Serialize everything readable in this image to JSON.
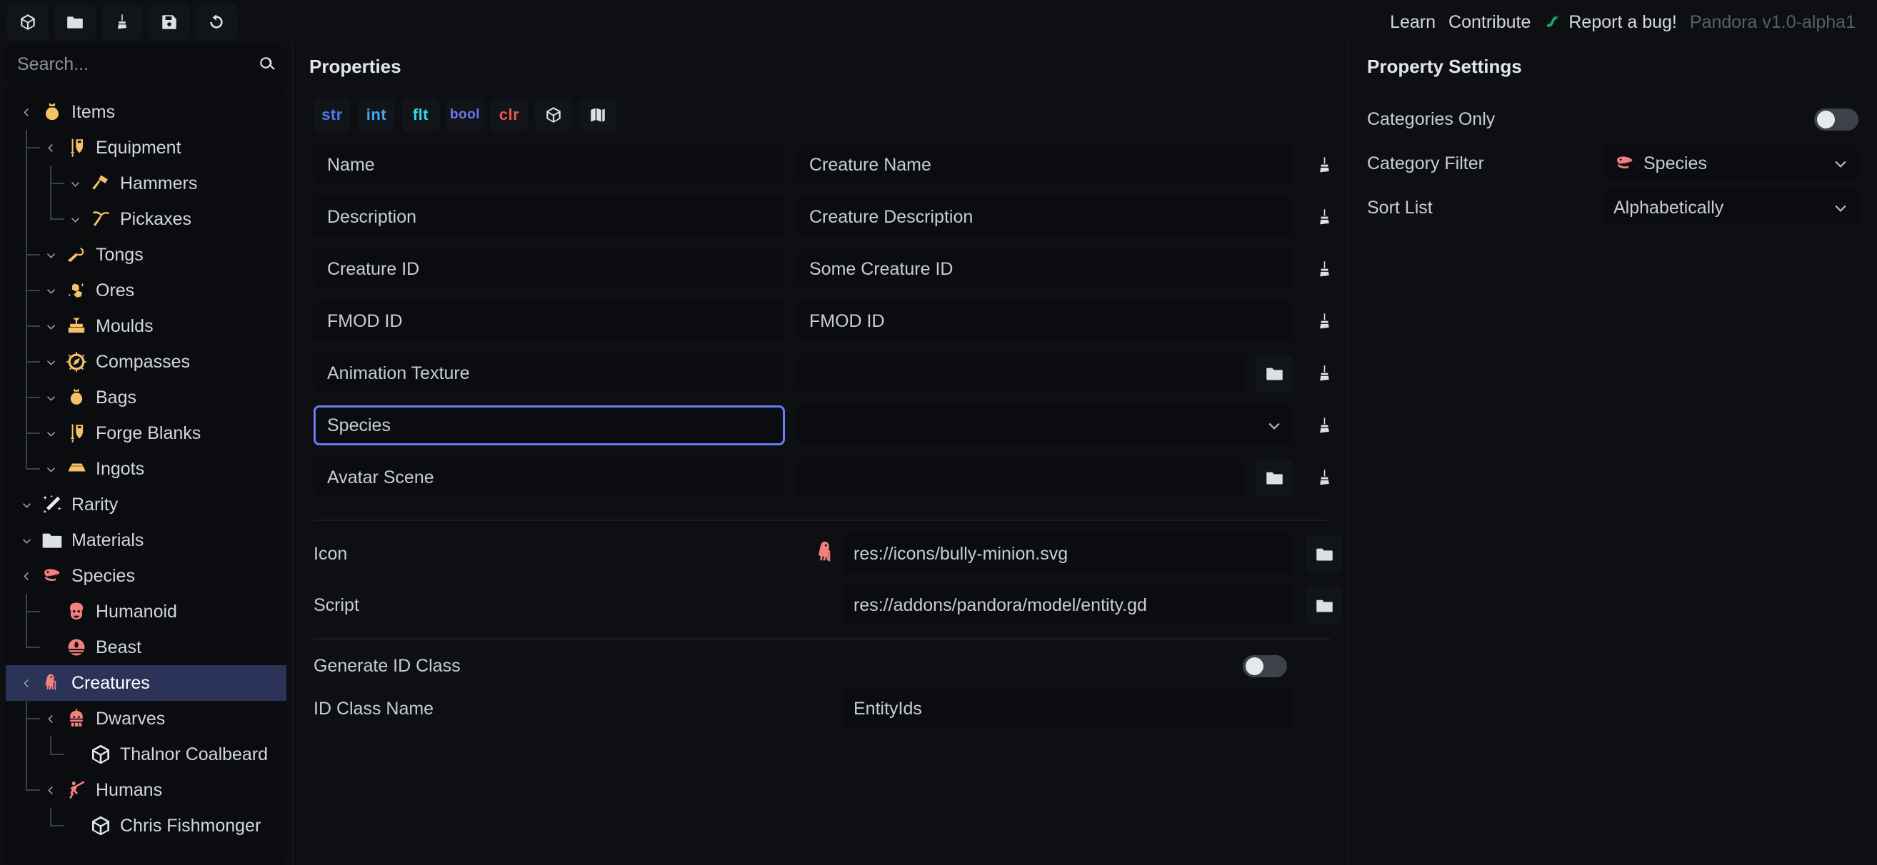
{
  "toolbar": {
    "buttons": [
      {
        "name": "new-entity-button",
        "icon": "cube-icon",
        "label": "New"
      },
      {
        "name": "open-folder-button",
        "icon": "folder-icon",
        "label": "Open"
      },
      {
        "name": "clean-button",
        "icon": "broom-icon",
        "label": "Clean"
      },
      {
        "name": "save-button",
        "icon": "floppy-disk-icon",
        "label": "Save"
      },
      {
        "name": "refresh-button",
        "icon": "undo-arrow-icon",
        "label": "Refresh"
      }
    ]
  },
  "header": {
    "learn_label": "Learn",
    "contribute_label": "Contribute",
    "report_bug_label": "Report a bug!",
    "bug_icon": "caterpillar-icon",
    "version": "Pandora v1.0-alpha1",
    "accent_green": "#14a764"
  },
  "search": {
    "placeholder": "Search...",
    "value": "",
    "icon": "search-icon"
  },
  "tree": {
    "selected": "Creatures",
    "items": [
      {
        "label": "Items",
        "depth": 0,
        "caret": "open",
        "icon": "money-bag-icon",
        "color": "#f5c265"
      },
      {
        "label": "Equipment",
        "depth": 1,
        "caret": "open",
        "icon": "sword-shield-icon",
        "color": "#f5c265"
      },
      {
        "label": "Hammers",
        "depth": 2,
        "caret": "closed",
        "icon": "hammer-icon",
        "color": "#f5c265"
      },
      {
        "label": "Pickaxes",
        "depth": 2,
        "caret": "closed",
        "icon": "pickaxe-icon",
        "color": "#f5c265"
      },
      {
        "label": "Tongs",
        "depth": 1,
        "caret": "closed",
        "icon": "tongs-icon",
        "color": "#f5c265"
      },
      {
        "label": "Ores",
        "depth": 1,
        "caret": "closed",
        "icon": "ore-rock-icon",
        "color": "#f5c265"
      },
      {
        "label": "Moulds",
        "depth": 1,
        "caret": "closed",
        "icon": "mould-icon",
        "color": "#f5c265"
      },
      {
        "label": "Compasses",
        "depth": 1,
        "caret": "closed",
        "icon": "compass-icon",
        "color": "#f5c265"
      },
      {
        "label": "Bags",
        "depth": 1,
        "caret": "closed",
        "icon": "bag-icon",
        "color": "#f5c265"
      },
      {
        "label": "Forge Blanks",
        "depth": 1,
        "caret": "closed",
        "icon": "sword-shield-icon",
        "color": "#f5c265"
      },
      {
        "label": "Ingots",
        "depth": 1,
        "caret": "closed",
        "icon": "ingot-icon",
        "color": "#f5c265"
      },
      {
        "label": "Rarity",
        "depth": 0,
        "caret": "closed",
        "icon": "sparkle-shooting-star-icon",
        "color": "#e9edf2"
      },
      {
        "label": "Materials",
        "depth": 0,
        "caret": "closed",
        "icon": "folder-icon",
        "color": "#dde1e6"
      },
      {
        "label": "Species",
        "depth": 0,
        "caret": "open",
        "icon": "dino-skull-icon",
        "color": "#f4807e"
      },
      {
        "label": "Humanoid",
        "depth": 1,
        "caret": "none",
        "icon": "ape-head-icon",
        "color": "#f4807e"
      },
      {
        "label": "Beast",
        "depth": 1,
        "caret": "none",
        "icon": "beast-eye-icon",
        "color": "#f4807e"
      },
      {
        "label": "Creatures",
        "depth": 0,
        "caret": "open",
        "icon": "creature-icon",
        "color": "#f4807e"
      },
      {
        "label": "Dwarves",
        "depth": 1,
        "caret": "open",
        "icon": "dwarf-helm-icon",
        "color": "#f4807e"
      },
      {
        "label": "Thalnor Coalbeard",
        "depth": 2,
        "caret": "none",
        "icon": "cube-icon",
        "color": "#e4e7eb"
      },
      {
        "label": "Humans",
        "depth": 1,
        "caret": "open",
        "icon": "spear-runner-icon",
        "color": "#f4807e"
      },
      {
        "label": "Chris Fishmonger",
        "depth": 2,
        "caret": "none",
        "icon": "cube-icon",
        "color": "#e4e7eb"
      }
    ]
  },
  "properties_panel": {
    "title": "Properties",
    "type_filters": [
      {
        "label": "str",
        "name": "filter-string",
        "color": "#4e7cf0",
        "kind": "text"
      },
      {
        "label": "int",
        "name": "filter-int",
        "color": "#43a6f5",
        "kind": "text"
      },
      {
        "label": "flt",
        "name": "filter-float",
        "color": "#31d9e0",
        "kind": "text"
      },
      {
        "label": "bool",
        "name": "filter-bool",
        "color": "#6f74f0",
        "kind": "text"
      },
      {
        "label": "clr",
        "name": "filter-color",
        "color": "#f0564e",
        "kind": "text"
      },
      {
        "label": "",
        "name": "filter-resource",
        "color": "#dde0e4",
        "kind": "cube-icon"
      },
      {
        "label": "",
        "name": "filter-map",
        "color": "#dde0e4",
        "kind": "map-icon"
      }
    ],
    "rows": [
      {
        "name": "Name",
        "value": "Creature Name",
        "kind": "text",
        "focused": false
      },
      {
        "name": "Description",
        "value": "Creature Description",
        "kind": "text",
        "focused": false
      },
      {
        "name": "Creature ID",
        "value": "Some Creature ID",
        "kind": "text",
        "focused": false
      },
      {
        "name": "FMOD ID",
        "value": "FMOD ID",
        "kind": "text",
        "focused": false
      },
      {
        "name": "Animation Texture",
        "value": "",
        "kind": "resource",
        "focused": false
      },
      {
        "name": "Species",
        "value": "",
        "kind": "dropdown",
        "focused": true
      },
      {
        "name": "Avatar Scene",
        "value": "",
        "kind": "resource",
        "focused": false
      }
    ],
    "meta": {
      "icon_label": "Icon",
      "icon_value": "res://icons/bully-minion.svg",
      "icon_preview": "bully-minion-icon",
      "script_label": "Script",
      "script_value": "res://addons/pandora/model/entity.gd",
      "generate_id_class_label": "Generate ID Class",
      "generate_id_class_on": false,
      "id_class_name_label": "ID Class Name",
      "id_class_name_value": "EntityIds"
    }
  },
  "settings_panel": {
    "title": "Property Settings",
    "categories_only_label": "Categories Only",
    "categories_only_on": false,
    "category_filter_label": "Category Filter",
    "category_filter_value": "Species",
    "category_filter_icon": "dino-skull-icon",
    "sort_list_label": "Sort List",
    "sort_list_value": "Alphabetically"
  },
  "colors": {
    "bg": "#0d0f13",
    "panel": "#0a0c10",
    "focus_blue": "#6a7bf5",
    "selection": "#2b3358",
    "item_gold": "#f5c265",
    "species_salmon": "#f4807e"
  }
}
